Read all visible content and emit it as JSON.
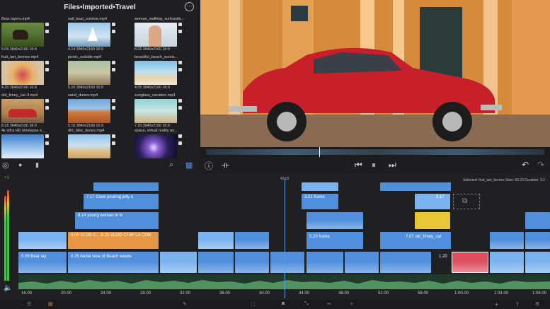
{
  "browser": {
    "title": "Files•Imported•Travel",
    "clips": [
      {
        "name": "Bear layers.mp4",
        "meta": "5.09 3840x2160 16:9",
        "thumb": "bear"
      },
      {
        "name": "sail_boat_sunrise.mp4",
        "meta": "4.14 3840x2160 16:9",
        "thumb": "sail"
      },
      {
        "name": "woman_walking_surfcastle...",
        "meta": "8.06 3840x2160 16:9",
        "thumb": "woman"
      },
      {
        "name": "fruit_tart_berries.mp4",
        "meta": "4.20 3840x2160 16:9",
        "thumb": "tart"
      },
      {
        "name": "picnic_outside.mp4",
        "meta": "5.16 3840x2160 16:9",
        "thumb": "picnic"
      },
      {
        "name": "beautiful_beach_sunris...",
        "meta": "4.05 3840x2160 16:9",
        "thumb": "beach"
      },
      {
        "name": "old_timey_car-3.mp4",
        "meta": "8.18 3840x2160 16:9",
        "thumb": "car"
      },
      {
        "name": "sand_dunes.mp4",
        "meta": "5.16 3840x2160 16:9",
        "thumb": "dunes"
      },
      {
        "name": "sunglass_vacation.mp4",
        "meta": "7.20 3840x2160 16:9",
        "thumb": "sunglass"
      },
      {
        "name": "4k ultra HD timelapse e...",
        "meta": "",
        "thumb": "sky"
      },
      {
        "name": "dirt_bike_dunes.mp4",
        "meta": "",
        "thumb": "dirt"
      },
      {
        "name": "space, virtual reality an...",
        "meta": "",
        "thumb": "space"
      }
    ]
  },
  "timeline": {
    "playhead_time": "42:22",
    "selected_info": "Selected: fruit_tart_berries Start: 50.23 Duration: 3.2",
    "level_top": "+1",
    "ruler": [
      "16.00",
      "20.00",
      "24.00",
      "28.00",
      "32.00",
      "36.00",
      "40.00",
      "44.00",
      "48.00",
      "52.00",
      "56.00",
      "1:00.00",
      "1:04.00",
      "1:08.00"
    ],
    "clips": {
      "cook": "7.17 Cook pouring jelly o",
      "young_woman": "8.14 young woman in lo",
      "vlog_orange": "0.05 VLOG C... 8.20 VLOG CTAF LA CON",
      "frame_top": "3.21 frame",
      "frame_yellow": "5.20 frame",
      "old_timey": "7.07 old_timey_car",
      "bear": "5.09 Bear lay",
      "aerial": "0.25 Aerial view of Beach waves",
      "mid_label": "1.20",
      "selected_label": "3.17"
    }
  },
  "colors": {
    "clip_blue": "#4f8fdc",
    "clip_orange": "#e79644",
    "clip_yellow": "#e6c636",
    "clip_selected": "#e05062"
  }
}
